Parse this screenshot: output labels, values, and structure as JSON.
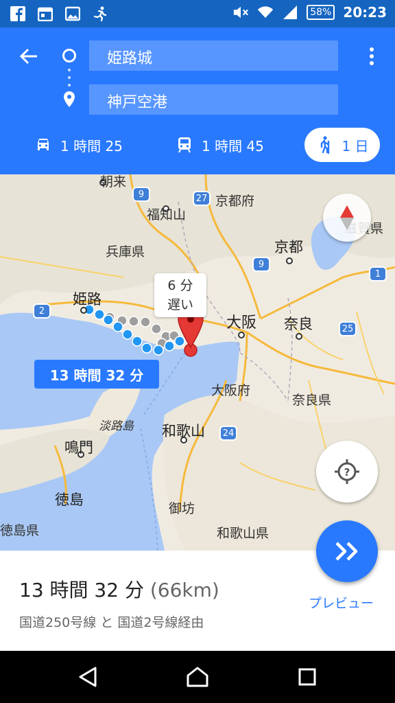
{
  "status_bar": {
    "battery_percent": "58%",
    "time": "20:23",
    "icons": [
      "facebook-icon",
      "calendar-icon",
      "gallery-icon",
      "running-icon",
      "mute-icon",
      "wifi-icon",
      "signal-icon",
      "battery-icon"
    ]
  },
  "directions": {
    "origin": "姫路城",
    "destination": "神戸空港",
    "modes": [
      {
        "icon": "car-icon",
        "label": "1 時間 25"
      },
      {
        "icon": "transit-icon",
        "label": "1 時間 45"
      },
      {
        "icon": "walk-icon",
        "label": "1 日",
        "selected": true
      }
    ]
  },
  "map": {
    "labels": {
      "asago": "朝来",
      "fukuchiyama": "福知山",
      "kyoto_pref": "京都府",
      "shiga_pref": "滋賀県",
      "hyogo_pref": "兵庫県",
      "kyoto": "京都",
      "himeji": "姫路",
      "osaka": "大阪",
      "nara": "奈良",
      "osaka_pref": "大阪府",
      "nara_pref": "奈良県",
      "awajishima": "淡路島",
      "wakayama": "和歌山",
      "naruto": "鳴門",
      "tokushima": "徳島",
      "gobo": "御坊",
      "tokushima_pref": "徳島県",
      "wakayama_pref": "和歌山県"
    },
    "shields": {
      "r9a": "9",
      "r27": "27",
      "r9b": "9",
      "r1": "1",
      "r2": "2",
      "r25": "25",
      "r24": "24"
    },
    "delay_bubble": {
      "line1": "6 分",
      "line2": "遅い"
    },
    "route_time_bubble": "13 時間 32 分",
    "accent": "#2979ff",
    "route_color": "#2196f3",
    "alt_route_color": "#9e9e9e",
    "pin_color": "#e53935"
  },
  "summary": {
    "duration": "13 時間 32 分",
    "distance": "(66km)",
    "via": "国道250号線 と 国道2号線経由",
    "preview_label": "プレビュー"
  }
}
